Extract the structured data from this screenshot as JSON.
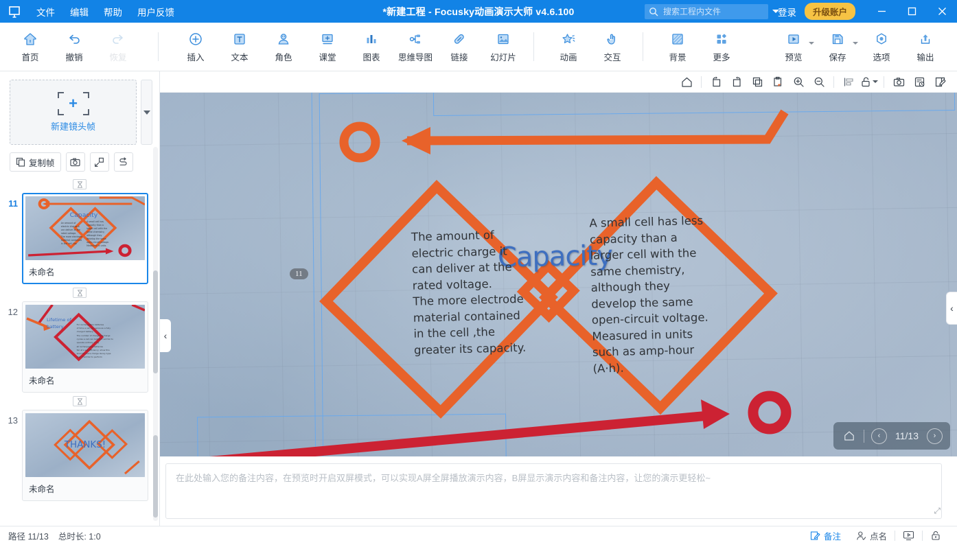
{
  "titlebar": {
    "logo_icon": "focusky-logo-icon",
    "menus": [
      {
        "label": "文件",
        "name": "menu-file"
      },
      {
        "label": "编辑",
        "name": "menu-edit"
      },
      {
        "label": "帮助",
        "name": "menu-help"
      },
      {
        "label": "用户反馈",
        "name": "menu-feedback"
      }
    ],
    "title": "*新建工程 - Focusky动画演示大师  v4.6.100",
    "search_placeholder": "搜索工程内文件",
    "search_value": "",
    "login_label": "登录",
    "upgrade_label": "升级账户",
    "minimize_label": "—",
    "maximize_label": "□",
    "close_label": "✕",
    "bg_color": "#1283e6",
    "upgrade_color": "#f6c344"
  },
  "ribbon": {
    "groups": [
      {
        "name": "group-history",
        "items": [
          {
            "label": "首页",
            "icon": "home-icon",
            "name": "ribbon-home",
            "disabled": false,
            "split": false
          },
          {
            "label": "撤销",
            "icon": "undo-icon",
            "name": "ribbon-undo",
            "disabled": false,
            "split": false
          },
          {
            "label": "恢复",
            "icon": "redo-icon",
            "name": "ribbon-redo",
            "disabled": true,
            "split": false
          }
        ]
      },
      {
        "name": "group-insert",
        "items": [
          {
            "label": "插入",
            "icon": "plus-circle-icon",
            "name": "ribbon-insert",
            "disabled": false,
            "split": false
          },
          {
            "label": "文本",
            "icon": "text-icon",
            "name": "ribbon-text",
            "disabled": false,
            "split": false
          },
          {
            "label": "角色",
            "icon": "character-icon",
            "name": "ribbon-character",
            "disabled": false,
            "split": false
          },
          {
            "label": "课堂",
            "icon": "classroom-icon",
            "name": "ribbon-classroom",
            "disabled": false,
            "split": false
          },
          {
            "label": "图表",
            "icon": "chart-icon",
            "name": "ribbon-chart",
            "disabled": false,
            "split": false
          },
          {
            "label": "思维导图",
            "icon": "mindmap-icon",
            "name": "ribbon-mindmap",
            "disabled": false,
            "split": false
          },
          {
            "label": "链接",
            "icon": "link-icon",
            "name": "ribbon-link",
            "disabled": false,
            "split": false
          },
          {
            "label": "幻灯片",
            "icon": "slide-icon",
            "name": "ribbon-slide",
            "disabled": false,
            "split": false
          }
        ]
      },
      {
        "name": "group-effects",
        "items": [
          {
            "label": "动画",
            "icon": "animation-star-icon",
            "name": "ribbon-animation",
            "disabled": false,
            "split": false
          },
          {
            "label": "交互",
            "icon": "interaction-hand-icon",
            "name": "ribbon-interaction",
            "disabled": false,
            "split": false
          }
        ]
      },
      {
        "name": "group-design",
        "items": [
          {
            "label": "背景",
            "icon": "background-icon",
            "name": "ribbon-background",
            "disabled": false,
            "split": false
          },
          {
            "label": "更多",
            "icon": "more-grid-icon",
            "name": "ribbon-more",
            "disabled": false,
            "split": false
          }
        ]
      },
      {
        "name": "group-output",
        "items": [
          {
            "label": "预览",
            "icon": "preview-play-icon",
            "name": "ribbon-preview",
            "disabled": false,
            "split": true
          },
          {
            "label": "保存",
            "icon": "save-disk-icon",
            "name": "ribbon-save",
            "disabled": false,
            "split": true
          },
          {
            "label": "选项",
            "icon": "options-gear-icon",
            "name": "ribbon-options",
            "disabled": false,
            "split": false
          },
          {
            "label": "输出",
            "icon": "export-upload-icon",
            "name": "ribbon-export",
            "disabled": false,
            "split": false
          }
        ]
      }
    ]
  },
  "leftpanel": {
    "new_frame_label": "新建镜头帧",
    "new_frame_dropdown_icon": "chevron-down-icon",
    "tools": [
      {
        "label": "复制帧",
        "icon": "copy-frame-icon",
        "name": "duplicate-frame-button",
        "square": false
      },
      {
        "label": "",
        "icon": "camera-icon",
        "name": "capture-frame-button",
        "square": true
      },
      {
        "label": "",
        "icon": "fit-frame-icon",
        "name": "fit-frame-button",
        "square": true
      },
      {
        "label": "",
        "icon": "reorder-path-icon",
        "name": "reorder-path-button",
        "square": true
      }
    ],
    "slides": [
      {
        "number": "11",
        "title": "未命名",
        "active": true,
        "thumb": "capacity"
      },
      {
        "number": "12",
        "title": "未命名",
        "active": false,
        "thumb": "lifetime"
      },
      {
        "number": "13",
        "title": "未命名",
        "active": false,
        "thumb": "thanks"
      }
    ],
    "timer_icon": "timer-chip-icon"
  },
  "canvas_toolbar": {
    "buttons": [
      {
        "icon": "home-outline-icon",
        "name": "cv-home-button"
      },
      {
        "icon": "rotate-left-icon",
        "name": "cv-rotate-left-button"
      },
      {
        "icon": "rotate-right-icon",
        "name": "cv-rotate-right-button"
      },
      {
        "icon": "copy-icon",
        "name": "cv-copy-button"
      },
      {
        "icon": "paste-icon",
        "name": "cv-paste-button"
      },
      {
        "icon": "zoom-in-icon",
        "name": "cv-zoom-in-button"
      },
      {
        "icon": "zoom-out-icon",
        "name": "cv-zoom-out-button"
      },
      {
        "icon": "align-icon",
        "name": "cv-align-button"
      },
      {
        "icon": "unlock-icon",
        "name": "cv-lock-button"
      },
      {
        "icon": "camera-icon",
        "name": "cv-snapshot-button"
      },
      {
        "icon": "frame-history-icon",
        "name": "cv-frame-history-button"
      },
      {
        "icon": "edit-pencil-icon",
        "name": "cv-edit-button"
      }
    ]
  },
  "stage": {
    "frame_badge": "11",
    "title": "Capacity",
    "left_text": "The amount of\nelectric charge it\ncan deliver at the\nrated voltage.\n The more electrode\n material contained\n in the cell ,the\n   greater its capacity.",
    "right_text": "A small cell has less\ncapacity than a\nlarger cell with the\nsame chemistry,\nalthough they\n develop the same\nopen-circuit voltage.\n Measured in units\n such as amp-hour\n(A·h).",
    "accent_orange": "#e8622a",
    "accent_red": "#cc2233",
    "title_color": "#3e6fc0",
    "nav": {
      "home_icon": "home-outline-icon",
      "prev_icon": "chevron-left-icon",
      "next_icon": "chevron-right-icon",
      "counter": "11/13"
    },
    "collapse_left_icon": "chevron-left-icon",
    "collapse_right_icon": "chevron-left-icon"
  },
  "notes": {
    "placeholder": "在此处输入您的备注内容，在预览时开启双屏模式，可以实现A屏全屏播放演示内容，B屏显示演示内容和备注内容，让您的演示更轻松~",
    "value": "",
    "resize_icon": "resize-grip-icon"
  },
  "statusbar": {
    "path_label": "路径 11/13",
    "duration_label": "总时长: 1:0",
    "right_items": [
      {
        "label": "备注",
        "icon": "note-pencil-icon",
        "name": "status-notes-button",
        "accent": true
      },
      {
        "label": "点名",
        "icon": "roll-call-icon",
        "name": "status-rollcall-button",
        "accent": false
      },
      {
        "label": "",
        "icon": "presenter-screen-icon",
        "name": "status-presenter-button",
        "accent": false
      },
      {
        "label": "",
        "icon": "lock-icon",
        "name": "status-lock-button",
        "accent": false
      }
    ]
  }
}
